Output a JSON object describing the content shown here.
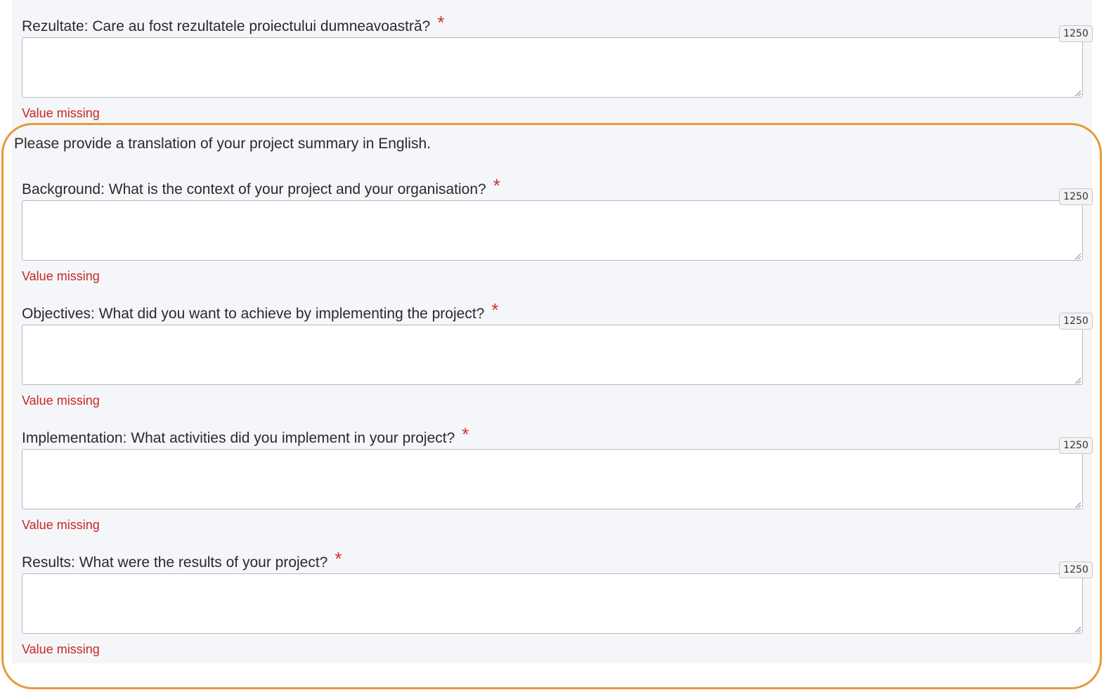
{
  "intro_text": "Please provide a translation of your project summary in English.",
  "fields": [
    {
      "label": "Rezultate: Care au fost rezultatele proiectului dumneavoastră?",
      "required_mark": "*",
      "value": "",
      "char_counter": "1250",
      "error": "Value missing"
    },
    {
      "label": "Background: What is the context of your project and your organisation?",
      "required_mark": "*",
      "value": "",
      "char_counter": "1250",
      "error": "Value missing"
    },
    {
      "label": "Objectives: What did you want to achieve by implementing the project?",
      "required_mark": "*",
      "value": "",
      "char_counter": "1250",
      "error": "Value missing"
    },
    {
      "label": "Implementation: What activities did you implement in your project?",
      "required_mark": "*",
      "value": "",
      "char_counter": "1250",
      "error": "Value missing"
    },
    {
      "label": "Results: What were the results of your project?",
      "required_mark": "*",
      "value": "",
      "char_counter": "1250",
      "error": "Value missing"
    }
  ],
  "colors": {
    "highlight_border": "#e8993b",
    "error_text": "#c62828",
    "required_mark": "#d32f2f",
    "panel_background": "#f5f6f9"
  },
  "icons": {
    "resize_handle": "resize-grip-icon"
  }
}
